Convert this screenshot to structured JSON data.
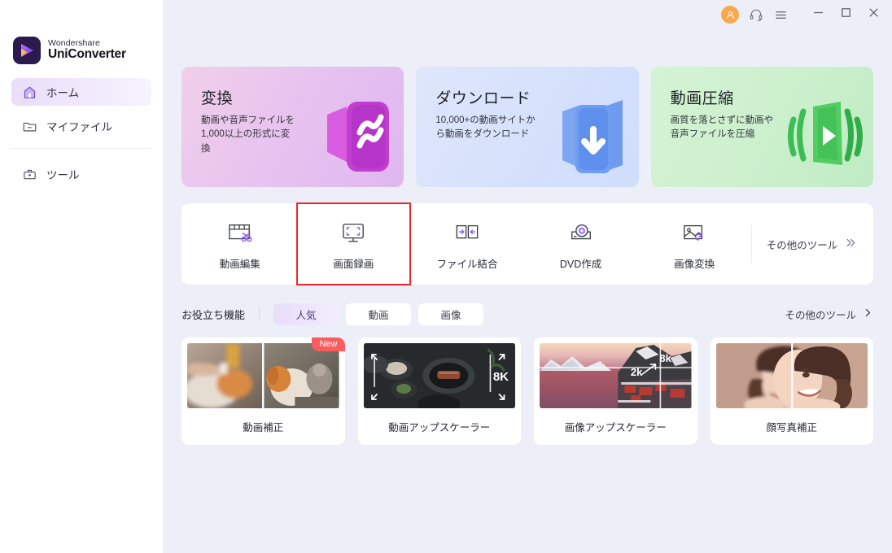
{
  "app": {
    "brand_line1": "Wondershare",
    "brand_line2": "UniConverter",
    "accent": "#7b4fe0",
    "highlight_color": "#f0252b",
    "avatar_color": "#f9a84d"
  },
  "titlebar": {
    "account_icon": "user-avatar-icon",
    "support_icon": "headset-icon",
    "menu_icon": "hamburger-menu-icon",
    "minimize_icon": "minimize-icon",
    "maximize_icon": "maximize-icon",
    "close_icon": "close-icon"
  },
  "sidebar": {
    "items": [
      {
        "label": "ホーム",
        "icon": "home-icon",
        "active": true
      },
      {
        "label": "マイファイル",
        "icon": "folder-icon",
        "active": false
      },
      {
        "label": "ツール",
        "icon": "toolbox-icon",
        "active": false
      }
    ]
  },
  "hero": {
    "cards": [
      {
        "title": "変換",
        "desc": "動画や音声ファイルを\n1,000以上の形式に変\n換",
        "icon": "convert-icon",
        "color": "#e0b7ef"
      },
      {
        "title": "ダウンロード",
        "desc": "10,000+の動画サイトか\nら動画をダウンロード",
        "icon": "download-icon",
        "color": "#cfddfc"
      },
      {
        "title": "動画圧縮",
        "desc": "画質を落とさずに動画や\n音声ファイルを圧縮",
        "icon": "compress-icon",
        "color": "#bfebc4"
      }
    ]
  },
  "tools": {
    "items": [
      {
        "label": "動画編集",
        "icon": "video-edit-icon",
        "highlighted": false
      },
      {
        "label": "画面録画",
        "icon": "screen-record-icon",
        "highlighted": true
      },
      {
        "label": "ファイル結合",
        "icon": "merge-files-icon",
        "highlighted": false
      },
      {
        "label": "DVD作成",
        "icon": "dvd-burn-icon",
        "highlighted": false
      },
      {
        "label": "画像変換",
        "icon": "image-convert-icon",
        "highlighted": false
      }
    ],
    "more_label": "その他のツール",
    "more_icon": "double-chevron-right-icon"
  },
  "filters": {
    "title": "お役立ち機能",
    "chips": [
      {
        "label": "人気",
        "active": true
      },
      {
        "label": "動画",
        "active": false
      },
      {
        "label": "画像",
        "active": false
      }
    ],
    "more_label": "その他のツール",
    "more_icon": "chevron-right-icon"
  },
  "features": {
    "cards": [
      {
        "label": "動画補正",
        "badge": "New",
        "thumb": "dog-before-after",
        "overlay": ""
      },
      {
        "label": "動画アップスケーラー",
        "badge": "",
        "thumb": "food-table",
        "overlay": "8K"
      },
      {
        "label": "画像アップスケーラー",
        "badge": "",
        "thumb": "fjord-village",
        "overlay": "2k",
        "overlay2": "8k"
      },
      {
        "label": "顔写真補正",
        "badge": "",
        "thumb": "portrait-before-after",
        "overlay": ""
      }
    ]
  }
}
